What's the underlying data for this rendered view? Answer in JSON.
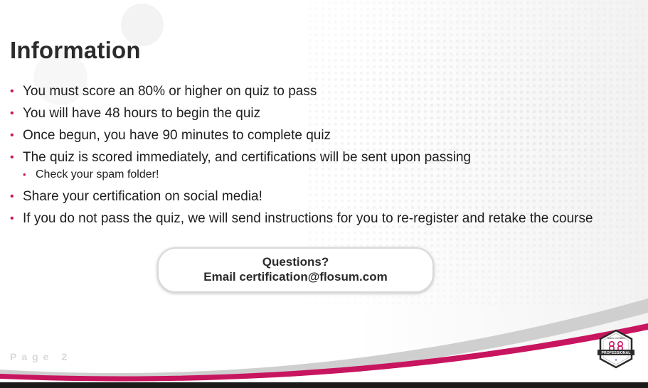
{
  "slide": {
    "title": "Information",
    "page_label": "Page 2",
    "bullets": [
      "You must score an 80% or higher on quiz to pass",
      "You will have 48 hours to begin the quiz",
      "Once begun, you have 90 minutes to complete quiz",
      "The quiz is scored immediately, and certifications will be sent upon passing",
      "Share your certification on social media!",
      "If you do not pass the quiz, we will send instructions for you to re-register and retake the course"
    ],
    "sub_bullet": "Check your spam folder!",
    "callout": {
      "line1": "Questions?",
      "line2": "Email certification@flosum.com"
    },
    "badge": {
      "top_text": "flosum Certified",
      "label": "PROFESSIONAL"
    }
  },
  "colors": {
    "accent": "#c8155f",
    "title": "#2b2b2b",
    "text": "#1e1e1e",
    "bottom_bar": "#1b1b1b"
  },
  "icons": {
    "badge": "certification-badge-icon"
  }
}
